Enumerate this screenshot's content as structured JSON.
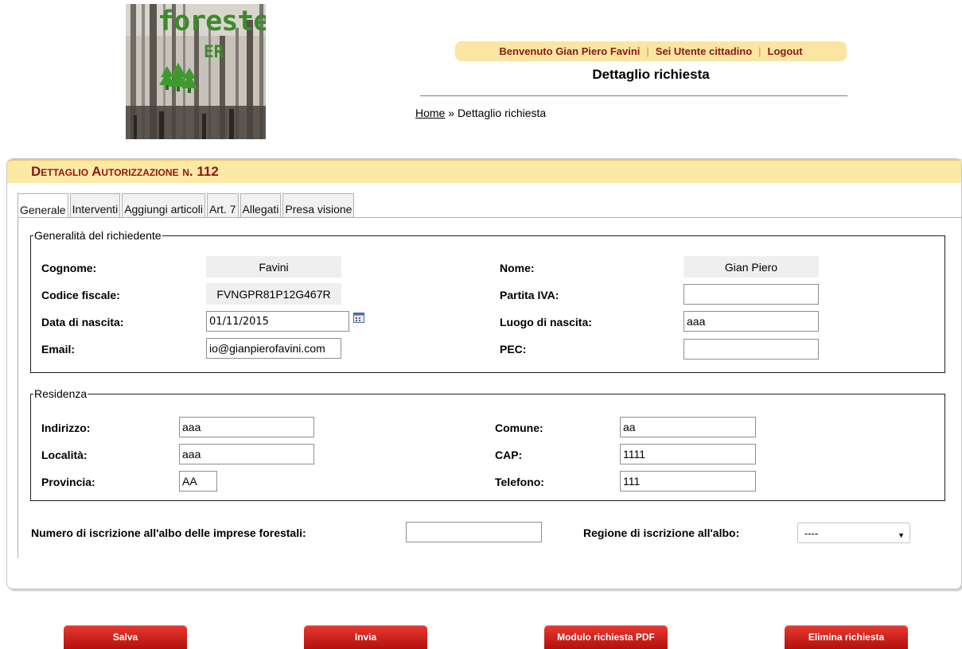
{
  "logo": {
    "line1": "foreste",
    "line2": "ER"
  },
  "userbar": {
    "welcome": "Benvenuto Gian Piero Favini",
    "role": "Sei Utente cittadino",
    "logout": "Logout"
  },
  "page_title": "Dettaglio richiesta",
  "breadcrumb": {
    "home": "Home",
    "sep": " » ",
    "current": "Dettaglio richiesta"
  },
  "panel": {
    "title": "Dettaglio Autorizzazione n. 112"
  },
  "tabs": [
    {
      "label": "Generale"
    },
    {
      "label": "Interventi"
    },
    {
      "label": "Aggiungi articoli"
    },
    {
      "label": "Art. 7"
    },
    {
      "label": "Allegati"
    },
    {
      "label": "Presa visione"
    }
  ],
  "generalita": {
    "legend": "Generalità del richiedente",
    "cognome_label": "Cognome:",
    "cognome": "Favini",
    "nome_label": "Nome:",
    "nome": "Gian Piero",
    "cf_label": "Codice fiscale:",
    "cf": "FVNGPR81P12G467R",
    "piva_label": "Partita IVA:",
    "piva": "",
    "nascita_label": "Data di nascita:",
    "nascita": "01/11/2015",
    "luogo_label": "Luogo di nascita:",
    "luogo": "aaa",
    "email_label": "Email:",
    "email": "io@gianpierofavini.com",
    "pec_label": "PEC:",
    "pec": ""
  },
  "residenza": {
    "legend": "Residenza",
    "indirizzo_label": "Indirizzo:",
    "indirizzo": "aaa",
    "comune_label": "Comune:",
    "comune": "aa",
    "localita_label": "Località:",
    "localita": "aaa",
    "cap_label": "CAP:",
    "cap": "1111",
    "provincia_label": "Provincia:",
    "provincia": "AA",
    "telefono_label": "Telefono:",
    "telefono": "111"
  },
  "albo": {
    "numero_label": "Numero di iscrizione all'albo delle imprese forestali:",
    "numero": "",
    "regione_label": "Regione di iscrizione all'albo:",
    "regione": "----"
  },
  "buttons": {
    "salva": "Salva",
    "invia": "Invia",
    "pdf": "Modulo richiesta PDF",
    "elimina": "Elimina richiesta"
  },
  "colors": {
    "accent_dark_red": "#8a1a10",
    "header_yellow": "#fde9a6",
    "button_red": "#c8201a"
  }
}
